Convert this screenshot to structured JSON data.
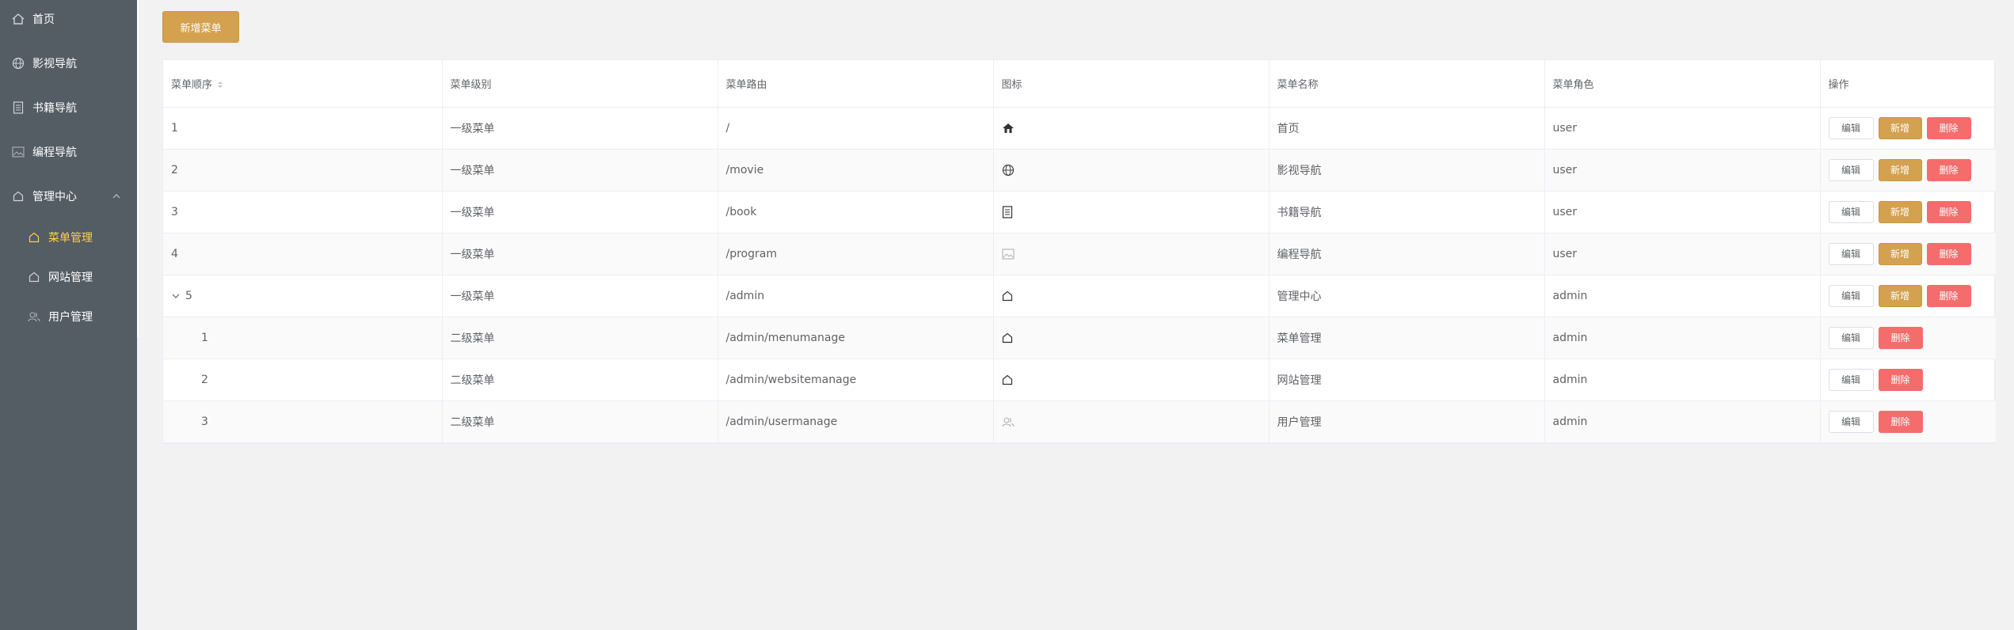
{
  "sidebar": {
    "items": [
      {
        "label": "首页",
        "icon": "home-icon"
      },
      {
        "label": "影视导航",
        "icon": "globe-icon"
      },
      {
        "label": "书籍导航",
        "icon": "book-icon"
      },
      {
        "label": "编程导航",
        "icon": "image-icon"
      },
      {
        "label": "管理中心",
        "icon": "house-icon",
        "expanded": true
      },
      {
        "label": "菜单管理",
        "icon": "house-icon",
        "active": true
      },
      {
        "label": "网站管理",
        "icon": "house-icon"
      },
      {
        "label": "用户管理",
        "icon": "users-icon"
      }
    ]
  },
  "toolbar": {
    "add_menu_label": "新增菜单"
  },
  "table": {
    "headers": [
      "菜单顺序",
      "菜单级别",
      "菜单路由",
      "图标",
      "菜单名称",
      "菜单角色",
      "操作"
    ],
    "rows": [
      {
        "order": "1",
        "level": "一级菜单",
        "route": "/",
        "icon": "home-icon",
        "name": "首页",
        "role": "user"
      },
      {
        "order": "2",
        "level": "一级菜单",
        "route": "/movie",
        "icon": "globe-icon",
        "name": "影视导航",
        "role": "user"
      },
      {
        "order": "3",
        "level": "一级菜单",
        "route": "/book",
        "icon": "book-icon",
        "name": "书籍导航",
        "role": "user"
      },
      {
        "order": "4",
        "level": "一级菜单",
        "route": "/program",
        "icon": "image-icon",
        "name": "编程导航",
        "role": "user"
      },
      {
        "order": "5",
        "level": "一级菜单",
        "route": "/admin",
        "icon": "house-icon",
        "name": "管理中心",
        "role": "admin"
      },
      {
        "order": "1",
        "level": "二级菜单",
        "route": "/admin/menumanage",
        "icon": "house-icon",
        "name": "菜单管理",
        "role": "admin"
      },
      {
        "order": "2",
        "level": "二级菜单",
        "route": "/admin/websitemanage",
        "icon": "house-icon",
        "name": "网站管理",
        "role": "admin"
      },
      {
        "order": "3",
        "level": "二级菜单",
        "route": "/admin/usermanage",
        "icon": "users-icon",
        "name": "用户管理",
        "role": "admin"
      }
    ],
    "actions": {
      "edit": "编辑",
      "add": "新增",
      "delete": "删除"
    }
  },
  "colors": {
    "sidebar_bg": "#545c64",
    "active_text": "#ffd04b",
    "primary_button": "#d4a14f",
    "danger_button": "#f56c6c",
    "page_bg": "#f2f2f2"
  }
}
